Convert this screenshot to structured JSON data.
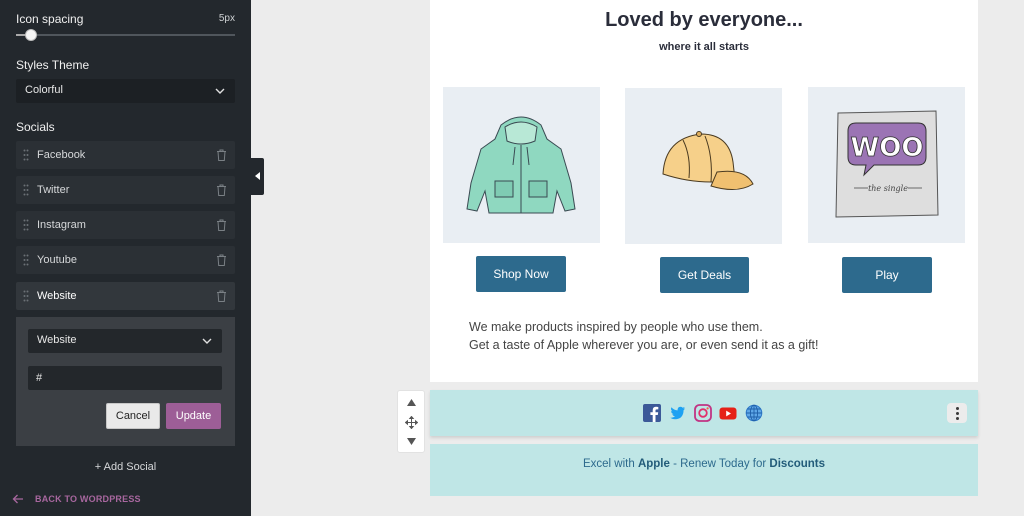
{
  "sidebar": {
    "icon_spacing_label": "Icon spacing",
    "icon_spacing_value": "5px",
    "icon_spacing_level": 0.05,
    "styles_theme_label": "Styles Theme",
    "styles_theme_value": "Colorful",
    "socials_label": "Socials",
    "socials": [
      {
        "label": "Facebook"
      },
      {
        "label": "Twitter"
      },
      {
        "label": "Instagram"
      },
      {
        "label": "Youtube"
      },
      {
        "label": "Website"
      }
    ],
    "edit": {
      "type_value": "Website",
      "url_value": "#",
      "cancel_label": "Cancel",
      "update_label": "Update"
    },
    "add_social_label": "+ Add Social",
    "back_label": "BACK TO WORDPRESS"
  },
  "email": {
    "headline": "Loved by everyone...",
    "subheadline": "where it all starts",
    "products": [
      {
        "name": "hoodie",
        "cta": "Shop Now"
      },
      {
        "name": "cap",
        "cta": "Get Deals"
      },
      {
        "name": "woo-poster",
        "cta": "Play",
        "logo_text": "WOO",
        "tagline": "the single"
      }
    ],
    "body_lines": [
      "We make products inspired by people who use them.",
      "Get a taste of Apple wherever you are, or even send it as a gift!"
    ],
    "social_icons": [
      "facebook-icon",
      "twitter-icon",
      "instagram-icon",
      "youtube-icon",
      "globe-icon"
    ],
    "footer": {
      "part1": "Excel with ",
      "bold1": "Apple",
      "part2": " - Renew Today for ",
      "bold2": "Discounts"
    }
  },
  "colors": {
    "sidebar_bg": "#23282d",
    "accent_purple": "#9d5e97",
    "cta_blue": "#2d6a8d",
    "social_bar_bg": "#bfe6e6",
    "facebook": "#3b5998",
    "twitter": "#1da1f2",
    "youtube": "#e62117"
  }
}
